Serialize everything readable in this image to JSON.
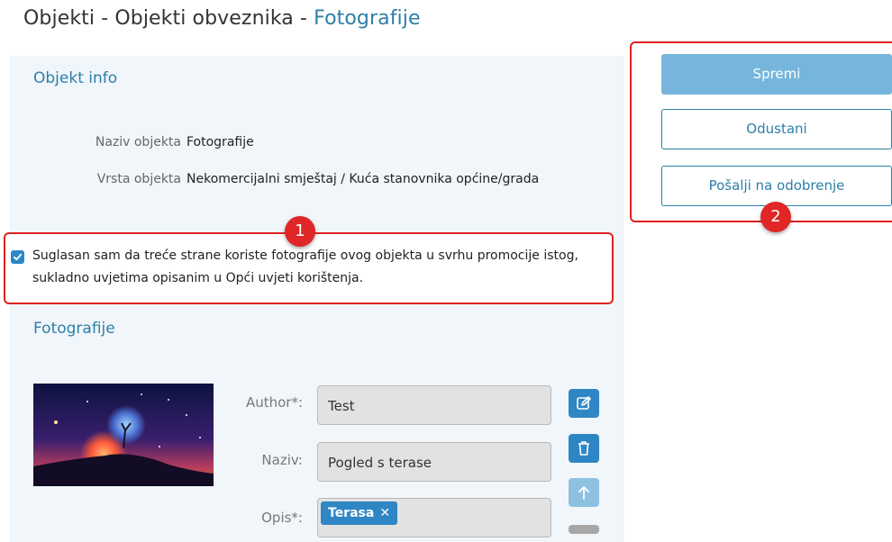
{
  "breadcrumb": {
    "part1": "Objekti",
    "sep1": " - ",
    "part2": "Objekti obveznika",
    "sep2": " - ",
    "current": "Fotografije"
  },
  "info": {
    "title": "Objekt info",
    "name_label": "Naziv objekta",
    "name_value": "Fotografije",
    "type_label": "Vrsta objekta",
    "type_value": "Nekomercijalni smještaj / Kuća stanovnika općine/grada"
  },
  "consent": {
    "checked": true,
    "line1": "Suglasan sam da treće strane koriste fotografije ovog objekta u svrhu promocije istog,",
    "line2": "sukladno uvjetima opisanim u Opći uvjeti korištenja."
  },
  "photos": {
    "title": "Fotografije",
    "author_label": "Author*:",
    "author_value": "Test",
    "name_label": "Naziv:",
    "name_value": "Pogled s terase",
    "desc_label": "Opis*:",
    "desc_tag": "Terasa",
    "tag_remove": "✕"
  },
  "actions": {
    "save_label": "Spremi",
    "cancel_label": "Odustani",
    "submit_label": "Pošalji na odobrenje"
  },
  "annotations": {
    "badge1": "1",
    "badge2": "2"
  },
  "icons": {
    "consent": "checkbox-checked-icon",
    "edit": "edit-icon",
    "delete": "trash-icon",
    "move_up": "arrow-up-icon"
  },
  "colors": {
    "accent": "#2d7fa8",
    "primary_button": "#76b6dc",
    "icon_button": "#2f86c4",
    "annotation_red": "#e02020"
  }
}
